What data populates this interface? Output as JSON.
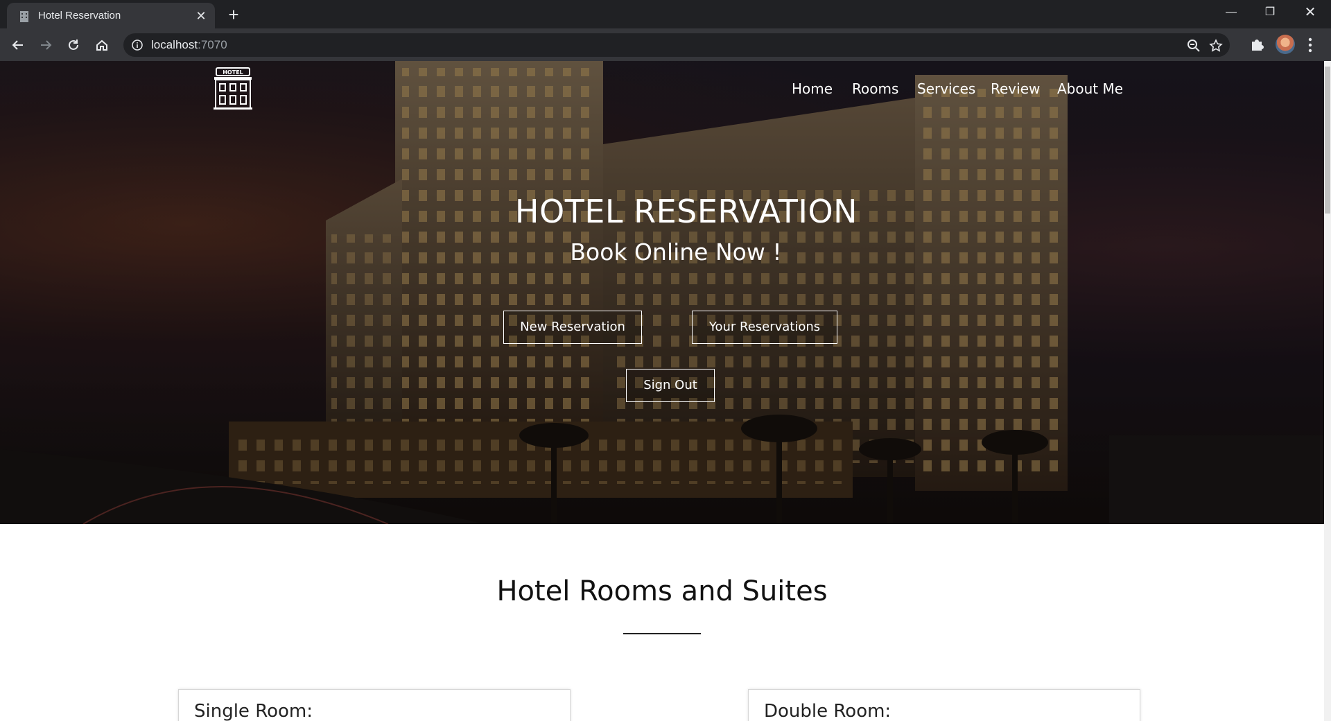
{
  "browser": {
    "tab_title": "Hotel Reservation",
    "url_host": "localhost",
    "url_port": ":7070"
  },
  "site": {
    "nav": [
      "Home",
      "Rooms",
      "Services",
      "Review",
      "About Me"
    ],
    "logo_text": "HOTEL"
  },
  "hero": {
    "title": "HOTEL RESERVATION",
    "subtitle": "Book Online Now !",
    "buttons": {
      "new_reservation": "New Reservation",
      "your_reservations": "Your Reservations",
      "sign_out": "Sign Out"
    }
  },
  "rooms": {
    "title": "Hotel Rooms and Suites",
    "cards": [
      "Single Room:",
      "Double Room:"
    ]
  },
  "colors": {
    "chrome_dark": "#202124",
    "chrome_mid": "#35363a",
    "hero_text": "#ffffff",
    "heading_text": "#111111"
  }
}
